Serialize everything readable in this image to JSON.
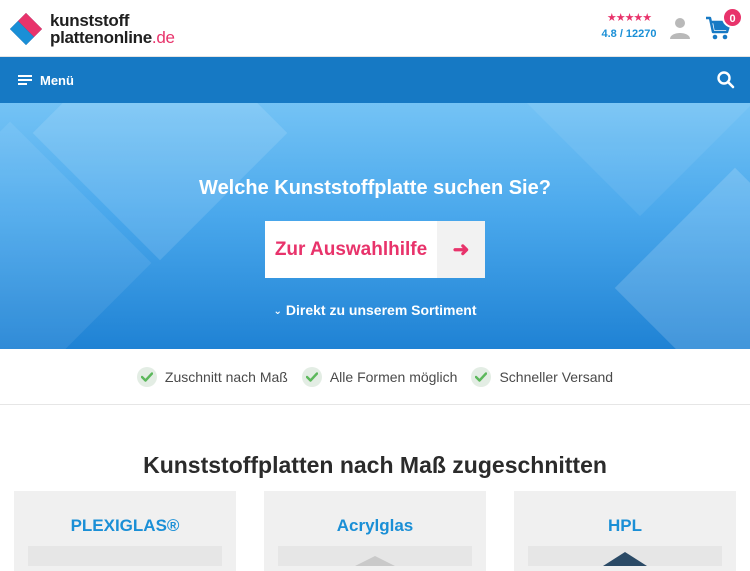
{
  "header": {
    "logo": {
      "line1": "kunststoff",
      "line2": "plattenonline",
      "tld": ".de"
    },
    "rating": {
      "stars": "★★★★★",
      "text": "4.8 / 12270"
    },
    "cart": {
      "count": "0"
    }
  },
  "nav": {
    "menu_label": "Menü"
  },
  "hero": {
    "title": "Welche Kunststoffplatte suchen Sie?",
    "cta_label": "Zur Auswahlhilfe",
    "cta_arrow": "➜",
    "direct_link": "Direkt zu unserem Sortiment"
  },
  "usps": [
    {
      "label": "Zuschnitt nach Maß"
    },
    {
      "label": "Alle Formen möglich"
    },
    {
      "label": "Schneller Versand"
    }
  ],
  "section": {
    "title": "Kunststoffplatten nach Maß zugeschnitten"
  },
  "cards": [
    {
      "title": "PLEXIGLAS®"
    },
    {
      "title": "Acrylglas"
    },
    {
      "title": "HPL"
    }
  ],
  "colors": {
    "accent": "#e8336b",
    "brand_blue": "#1679c4",
    "link_blue": "#1a8fd6",
    "check_green": "#5cb85c"
  }
}
